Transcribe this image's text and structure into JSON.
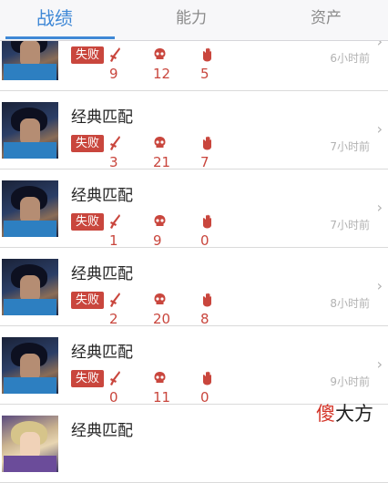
{
  "tabs": [
    {
      "label": "战绩",
      "active": true
    },
    {
      "label": "能力",
      "active": false
    },
    {
      "label": "资产",
      "active": false
    }
  ],
  "colors": {
    "accent": "#3f88d6",
    "loss": "#c9463d"
  },
  "rows": [
    {
      "title": "",
      "result": "失败",
      "kills": "9",
      "deaths": "12",
      "assists": "5",
      "time": "6小时前",
      "avatar": "champion-avatar-male"
    },
    {
      "title": "经典匹配",
      "result": "失败",
      "kills": "3",
      "deaths": "21",
      "assists": "7",
      "time": "7小时前",
      "avatar": "champion-avatar-male"
    },
    {
      "title": "经典匹配",
      "result": "失败",
      "kills": "1",
      "deaths": "9",
      "assists": "0",
      "time": "7小时前",
      "avatar": "champion-avatar-male"
    },
    {
      "title": "经典匹配",
      "result": "失败",
      "kills": "2",
      "deaths": "20",
      "assists": "8",
      "time": "8小时前",
      "avatar": "champion-avatar-male"
    },
    {
      "title": "经典匹配",
      "result": "失败",
      "kills": "0",
      "deaths": "11",
      "assists": "0",
      "time": "9小时前",
      "avatar": "champion-avatar-male"
    },
    {
      "title": "经典匹配",
      "result": "",
      "kills": "",
      "deaths": "",
      "assists": "",
      "time": "",
      "avatar": "champion-avatar-female"
    }
  ],
  "icons": {
    "kill": "sword-icon",
    "death": "skull-icon",
    "assist": "hand-icon",
    "chevron": "chevron-right-icon"
  },
  "watermark": {
    "first": "傻",
    "rest": "大方"
  }
}
